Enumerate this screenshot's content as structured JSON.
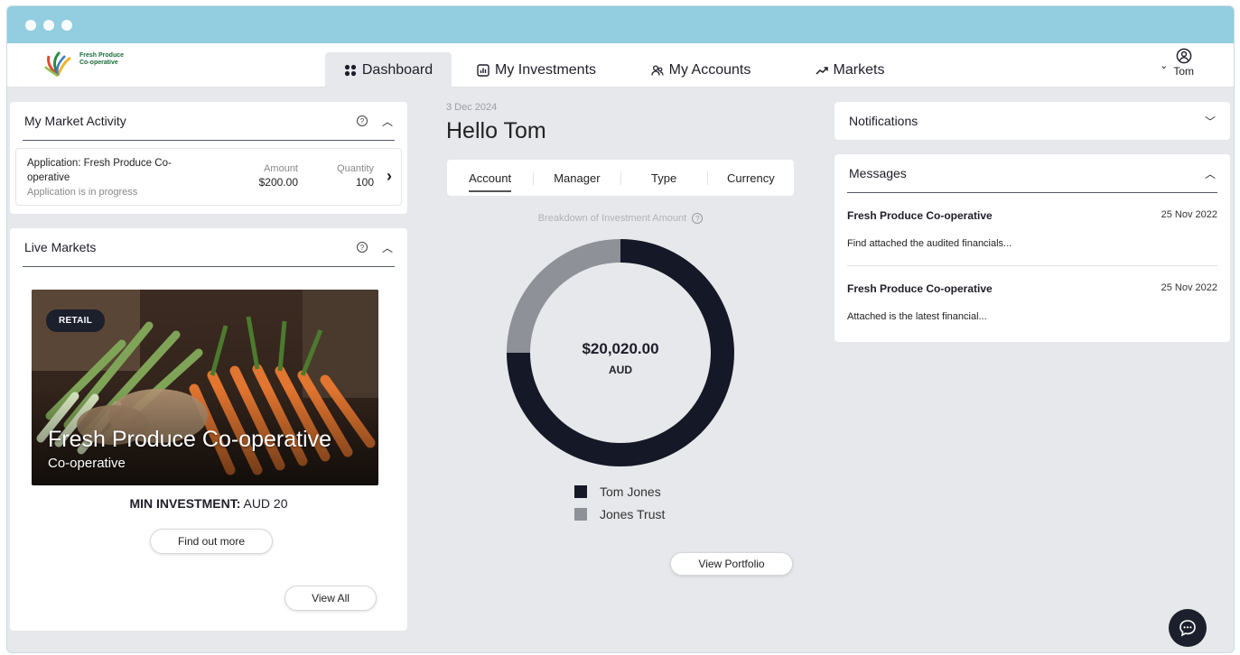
{
  "brand": {
    "name": "Fresh Produce Co-operative"
  },
  "nav": {
    "tabs": [
      {
        "label": "Dashboard",
        "icon": "grid-icon",
        "active": true
      },
      {
        "label": "My Investments",
        "icon": "bar-chart-icon",
        "active": false
      },
      {
        "label": "My Accounts",
        "icon": "users-icon",
        "active": false
      },
      {
        "label": "Markets",
        "icon": "trending-up-icon",
        "active": false
      }
    ],
    "user": {
      "name": "Tom",
      "icon": "user-circle-icon"
    }
  },
  "market_activity": {
    "title": "My Market Activity",
    "item": {
      "title": "Application: Fresh Produce Co-operative",
      "status": "Application is in progress",
      "amount_label": "Amount",
      "amount": "$200.00",
      "quantity_label": "Quantity",
      "quantity": "100"
    }
  },
  "live_markets": {
    "title": "Live Markets",
    "card": {
      "badge": "RETAIL",
      "name": "Fresh Produce Co-operative",
      "type": "Co-operative",
      "min_label": "MIN INVESTMENT:",
      "min_value": "AUD 20",
      "cta": "Find out more"
    },
    "view_all": "View All"
  },
  "dashboard": {
    "date": "3 Dec 2024",
    "greeting": "Hello Tom",
    "filters": [
      "Account",
      "Manager",
      "Type",
      "Currency"
    ],
    "breakdown_title": "Breakdown of Investment Amount",
    "total": "$20,020.00",
    "currency": "AUD",
    "view_portfolio": "View Portfolio"
  },
  "chart_data": {
    "type": "pie",
    "title": "Breakdown of Investment Amount",
    "categories": [
      "Tom Jones",
      "Jones Trust"
    ],
    "values": [
      0.75,
      0.25
    ],
    "colors": [
      "#151826",
      "#8e9197"
    ]
  },
  "notifications": {
    "title": "Notifications"
  },
  "messages": {
    "title": "Messages",
    "items": [
      {
        "sender": "Fresh Produce Co-operative",
        "date": "25 Nov 2022",
        "body": "Find attached the audited financials..."
      },
      {
        "sender": "Fresh Produce Co-operative",
        "date": "25 Nov 2022",
        "body": "Attached is the latest financial..."
      }
    ]
  },
  "colors": {
    "titlebar": "#93cde0",
    "accent_dark": "#1c1f2c",
    "background": "#e6e8eb"
  }
}
